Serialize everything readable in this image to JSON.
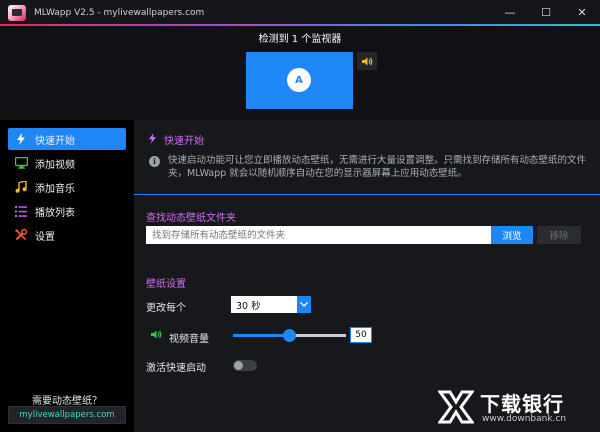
{
  "window": {
    "title": "MLWapp V2.5 - mylivewallpapers.com",
    "minimize": "—",
    "maximize": "☐",
    "close": "✕"
  },
  "monitor": {
    "detected_label": "检测到 1 个监视器",
    "badge": "A"
  },
  "sidebar": {
    "items": [
      {
        "label": "快速开始",
        "icon": "lightning-icon",
        "active": true
      },
      {
        "label": "添加视频",
        "icon": "monitor-icon",
        "active": false
      },
      {
        "label": "添加音乐",
        "icon": "music-note-icon",
        "active": false
      },
      {
        "label": "播放列表",
        "icon": "list-icon",
        "active": false
      },
      {
        "label": "设置",
        "icon": "tools-icon",
        "active": false
      }
    ],
    "promo_text": "需要动态壁纸？",
    "promo_link": "mylivewallpapers.com"
  },
  "main": {
    "section_title": "快速开始",
    "info_text": "快速启动功能可让您立即播放动态壁纸，无需进行大量设置调整。只需找到存储所有动态壁纸的文件夹，MLWapp 就会以随机顺序自动在您的显示器屏幕上应用动态壁纸。",
    "folder_label": "查找动态壁纸文件夹",
    "folder_placeholder": "找到存储所有动态壁纸的文件夹",
    "browse_label": "浏览",
    "remove_label": "移除",
    "wallpaper_label": "壁纸设置",
    "change_every_label": "更改每个",
    "change_every_value": "30 秒",
    "volume_label": "视频音量",
    "volume_value": "50",
    "volume_fraction": 0.5,
    "quick_start_label": "激活快速启动",
    "quick_start_on": false
  },
  "watermark": {
    "text": "下载银行",
    "url": "www.downbank.cn"
  },
  "colors": {
    "accent": "#1f86f5",
    "section": "#d06cf2",
    "link": "#49d7c8"
  }
}
